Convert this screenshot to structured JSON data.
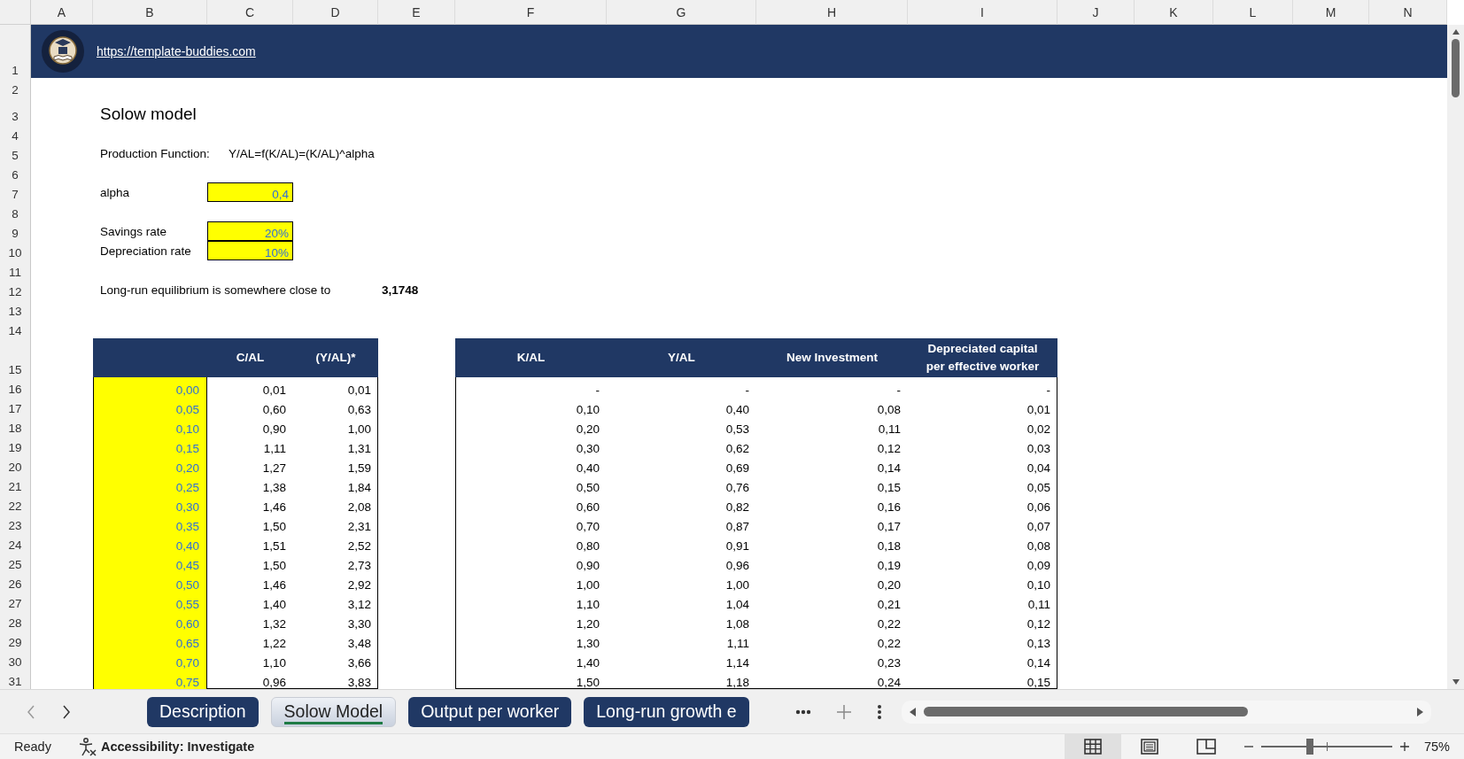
{
  "column_headers": [
    "A",
    "B",
    "C",
    "D",
    "E",
    "F",
    "G",
    "H",
    "I",
    "J",
    "K",
    "L",
    "M",
    "N"
  ],
  "row_headers": [
    "1",
    "2",
    "3",
    "4",
    "5",
    "6",
    "7",
    "8",
    "9",
    "10",
    "11",
    "12",
    "13",
    "14",
    "15",
    "16",
    "17",
    "18",
    "19",
    "20",
    "21",
    "22",
    "23",
    "24",
    "25",
    "26",
    "27",
    "28",
    "29",
    "30",
    "31"
  ],
  "banner": {
    "link": "https://template-buddies.com"
  },
  "title": "Solow model",
  "production_function": {
    "label": "Production Function:",
    "formula": "Y/AL=f(K/AL)=(K/AL)^alpha"
  },
  "parameters": [
    {
      "label": "alpha",
      "value": "0,4"
    },
    {
      "label": "Savings rate",
      "value": "20%"
    },
    {
      "label": "Depreciation rate",
      "value": "10%"
    }
  ],
  "equilibrium": {
    "label": "Long-run equilibrium is somewhere close to",
    "value": "3,1748"
  },
  "table_1": {
    "columns": [
      "C/AL",
      "(Y/AL)*"
    ],
    "rows": [
      [
        "0,00",
        "0,01",
        "0,01"
      ],
      [
        "0,05",
        "0,60",
        "0,63"
      ],
      [
        "0,10",
        "0,90",
        "1,00"
      ],
      [
        "0,15",
        "1,11",
        "1,31"
      ],
      [
        "0,20",
        "1,27",
        "1,59"
      ],
      [
        "0,25",
        "1,38",
        "1,84"
      ],
      [
        "0,30",
        "1,46",
        "2,08"
      ],
      [
        "0,35",
        "1,50",
        "2,31"
      ],
      [
        "0,40",
        "1,51",
        "2,52"
      ],
      [
        "0,45",
        "1,50",
        "2,73"
      ],
      [
        "0,50",
        "1,46",
        "2,92"
      ],
      [
        "0,55",
        "1,40",
        "3,12"
      ],
      [
        "0,60",
        "1,32",
        "3,30"
      ],
      [
        "0,65",
        "1,22",
        "3,48"
      ],
      [
        "0,70",
        "1,10",
        "3,66"
      ],
      [
        "0,75",
        "0,96",
        "3,83"
      ]
    ]
  },
  "table_2": {
    "columns": [
      "K/AL",
      "Y/AL",
      "New Investment",
      "Depreciated capital per effective worker"
    ],
    "rows": [
      [
        "-",
        "-",
        "-",
        "-"
      ],
      [
        "0,10",
        "0,40",
        "0,08",
        "0,01"
      ],
      [
        "0,20",
        "0,53",
        "0,11",
        "0,02"
      ],
      [
        "0,30",
        "0,62",
        "0,12",
        "0,03"
      ],
      [
        "0,40",
        "0,69",
        "0,14",
        "0,04"
      ],
      [
        "0,50",
        "0,76",
        "0,15",
        "0,05"
      ],
      [
        "0,60",
        "0,82",
        "0,16",
        "0,06"
      ],
      [
        "0,70",
        "0,87",
        "0,17",
        "0,07"
      ],
      [
        "0,80",
        "0,91",
        "0,18",
        "0,08"
      ],
      [
        "0,90",
        "0,96",
        "0,19",
        "0,09"
      ],
      [
        "1,00",
        "1,00",
        "0,20",
        "0,10"
      ],
      [
        "1,10",
        "1,04",
        "0,21",
        "0,11"
      ],
      [
        "1,20",
        "1,08",
        "0,22",
        "0,12"
      ],
      [
        "1,30",
        "1,11",
        "0,22",
        "0,13"
      ],
      [
        "1,40",
        "1,14",
        "0,23",
        "0,14"
      ],
      [
        "1,50",
        "1,18",
        "0,24",
        "0,15"
      ]
    ]
  },
  "tabs": [
    {
      "label": "Description",
      "selected": false
    },
    {
      "label": "Solow Model",
      "selected": true
    },
    {
      "label": "Output per worker",
      "selected": false
    },
    {
      "label": "Long-run growth e",
      "selected": false
    }
  ],
  "status_bar": {
    "mode": "Ready",
    "accessibility": "Accessibility: Investigate",
    "views": [
      {
        "kind": "normal",
        "selected": true
      },
      {
        "kind": "page_layout",
        "selected": false
      },
      {
        "kind": "page_break",
        "selected": false
      }
    ],
    "zoom": {
      "level": 0.37,
      "reading": "75%"
    }
  }
}
